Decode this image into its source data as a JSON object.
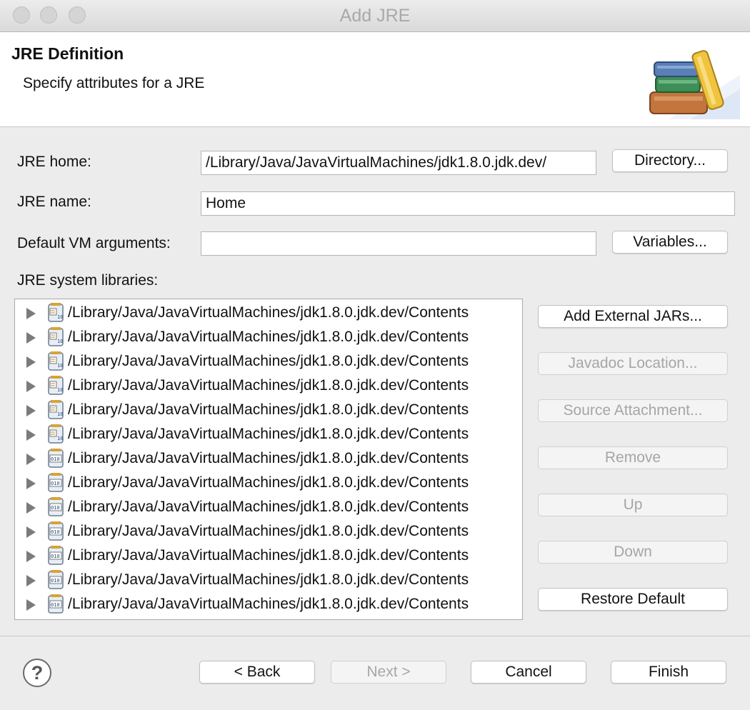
{
  "window": {
    "title": "Add JRE"
  },
  "header": {
    "title": "JRE Definition",
    "subtitle": "Specify attributes for a JRE"
  },
  "form": {
    "jre_home_label": "JRE home:",
    "jre_home_value": "/Library/Java/JavaVirtualMachines/jdk1.8.0.jdk.dev/",
    "directory_button": "Directory...",
    "jre_name_label": "JRE name:",
    "jre_name_value": "Home",
    "vm_args_label": "Default VM arguments:",
    "vm_args_value": "",
    "variables_button": "Variables...",
    "libraries_label": "JRE system libraries:"
  },
  "libraries": [
    {
      "path": "/Library/Java/JavaVirtualMachines/jdk1.8.0.jdk.dev/Contents",
      "icon": "source-jar-icon"
    },
    {
      "path": "/Library/Java/JavaVirtualMachines/jdk1.8.0.jdk.dev/Contents",
      "icon": "source-jar-icon"
    },
    {
      "path": "/Library/Java/JavaVirtualMachines/jdk1.8.0.jdk.dev/Contents",
      "icon": "source-jar-icon"
    },
    {
      "path": "/Library/Java/JavaVirtualMachines/jdk1.8.0.jdk.dev/Contents",
      "icon": "source-jar-icon"
    },
    {
      "path": "/Library/Java/JavaVirtualMachines/jdk1.8.0.jdk.dev/Contents",
      "icon": "source-jar-icon"
    },
    {
      "path": "/Library/Java/JavaVirtualMachines/jdk1.8.0.jdk.dev/Contents",
      "icon": "source-jar-icon"
    },
    {
      "path": "/Library/Java/JavaVirtualMachines/jdk1.8.0.jdk.dev/Contents",
      "icon": "binary-jar-icon"
    },
    {
      "path": "/Library/Java/JavaVirtualMachines/jdk1.8.0.jdk.dev/Contents",
      "icon": "binary-jar-icon"
    },
    {
      "path": "/Library/Java/JavaVirtualMachines/jdk1.8.0.jdk.dev/Contents",
      "icon": "binary-jar-icon"
    },
    {
      "path": "/Library/Java/JavaVirtualMachines/jdk1.8.0.jdk.dev/Contents",
      "icon": "binary-jar-icon"
    },
    {
      "path": "/Library/Java/JavaVirtualMachines/jdk1.8.0.jdk.dev/Contents",
      "icon": "binary-jar-icon"
    },
    {
      "path": "/Library/Java/JavaVirtualMachines/jdk1.8.0.jdk.dev/Contents",
      "icon": "binary-jar-icon"
    },
    {
      "path": "/Library/Java/JavaVirtualMachines/jdk1.8.0.jdk.dev/Contents",
      "icon": "binary-jar-icon"
    }
  ],
  "side_buttons": {
    "add_external_jars": "Add External JARs...",
    "javadoc_location": "Javadoc Location...",
    "source_attachment": "Source Attachment...",
    "remove": "Remove",
    "up": "Up",
    "down": "Down",
    "restore_default": "Restore Default"
  },
  "footer": {
    "help_glyph": "?",
    "back": "< Back",
    "next": "Next >",
    "cancel": "Cancel",
    "finish": "Finish"
  }
}
